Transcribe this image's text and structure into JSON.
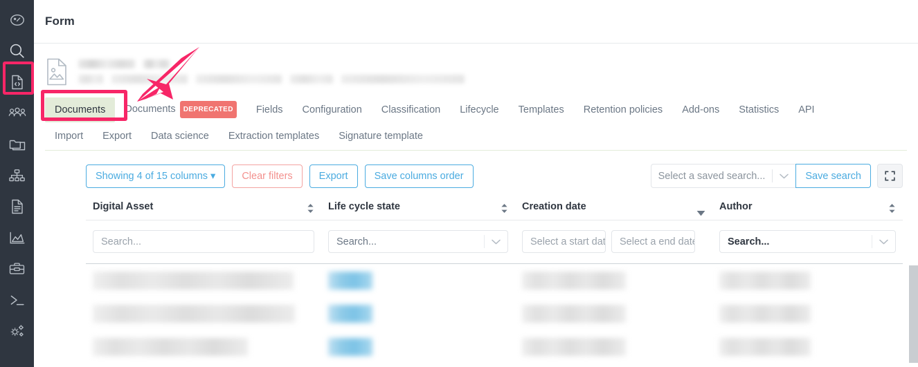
{
  "sidebar": {
    "items": [
      {
        "name": "dashboard-icon",
        "label": "Dashboard"
      },
      {
        "name": "search-icon",
        "label": "Search"
      },
      {
        "name": "code-document-icon",
        "label": "Document types"
      },
      {
        "name": "users-icon",
        "label": "Users"
      },
      {
        "name": "folder-icon",
        "label": "Folders"
      },
      {
        "name": "hierarchy-icon",
        "label": "Hierarchy"
      },
      {
        "name": "file-icon",
        "label": "Files"
      },
      {
        "name": "analytics-icon",
        "label": "Analytics"
      },
      {
        "name": "toolbox-icon",
        "label": "Toolbox"
      },
      {
        "name": "terminal-icon",
        "label": "Terminal"
      },
      {
        "name": "settings-gears-icon",
        "label": "Settings"
      }
    ],
    "highlighted_index": 2
  },
  "header": {
    "title": "Form"
  },
  "asset": {
    "icon": "image-document-icon"
  },
  "tabs": {
    "primary": [
      {
        "label": "Documents",
        "active": true,
        "badge": null
      },
      {
        "label": "Documents",
        "active": false,
        "badge": "DEPRECATED"
      },
      {
        "label": "Fields",
        "active": false,
        "badge": null
      },
      {
        "label": "Configuration",
        "active": false,
        "badge": null
      },
      {
        "label": "Classification",
        "active": false,
        "badge": null
      },
      {
        "label": "Lifecycle",
        "active": false,
        "badge": null
      },
      {
        "label": "Templates",
        "active": false,
        "badge": null
      },
      {
        "label": "Retention policies",
        "active": false,
        "badge": null
      },
      {
        "label": "Add-ons",
        "active": false,
        "badge": null
      },
      {
        "label": "Statistics",
        "active": false,
        "badge": null
      },
      {
        "label": "API",
        "active": false,
        "badge": null
      }
    ],
    "secondary": [
      {
        "label": "Import"
      },
      {
        "label": "Export"
      },
      {
        "label": "Data science"
      },
      {
        "label": "Extraction templates"
      },
      {
        "label": "Signature template"
      }
    ]
  },
  "toolbar": {
    "columns_button": "Showing 4 of 15 columns",
    "clear_filters_button": "Clear filters",
    "export_button": "Export",
    "save_columns_order_button": "Save columns order",
    "saved_search_placeholder": "Select a saved search...",
    "save_search_button": "Save search",
    "fullscreen_icon": "fullscreen-expand-icon"
  },
  "table": {
    "columns": [
      {
        "label": "Digital Asset",
        "sort": "sortable",
        "filter": "search",
        "placeholder": "Search..."
      },
      {
        "label": "Life cycle state",
        "sort": "sortable",
        "filter": "select",
        "placeholder": "Search..."
      },
      {
        "label": "Creation date",
        "sort": "desc",
        "filter": "daterange",
        "start_placeholder": "Select a start date",
        "end_placeholder": "Select a end date"
      },
      {
        "label": "Author",
        "sort": "sortable",
        "filter": "select",
        "placeholder": "Search..."
      }
    ],
    "rows": [
      {
        "digital_asset": "",
        "life_cycle_state": "",
        "creation_date": "",
        "author": ""
      },
      {
        "digital_asset": "",
        "life_cycle_state": "",
        "creation_date": "",
        "author": ""
      },
      {
        "digital_asset": "",
        "life_cycle_state": "",
        "creation_date": "",
        "author": ""
      }
    ]
  },
  "annotations": {
    "highlight_color": "#f72667",
    "active_tab_bg": "#e3ecd9",
    "arrow": "pink-pointer-arrow"
  }
}
